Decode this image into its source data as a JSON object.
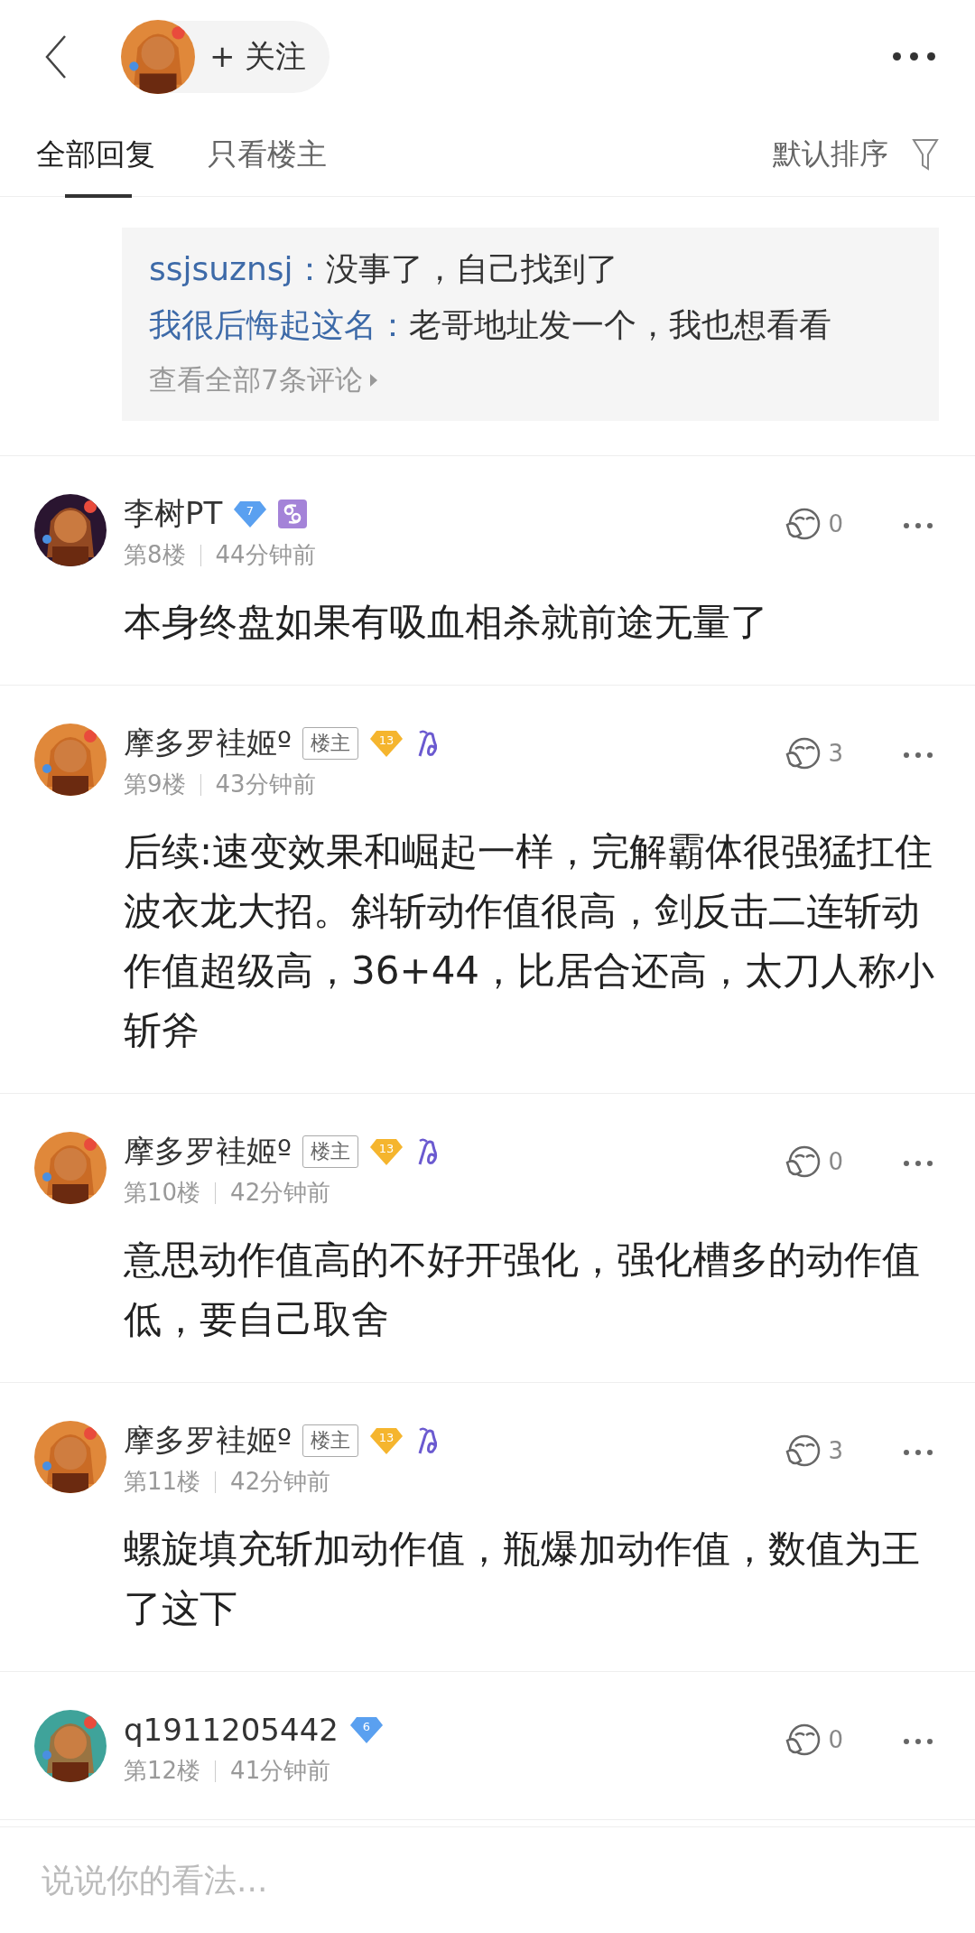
{
  "header": {
    "follow_label": "+ 关注"
  },
  "tabs": [
    {
      "label": "全部回复",
      "selected": true
    },
    {
      "label": "只看楼主",
      "selected": false
    }
  ],
  "sort": {
    "label": "默认排序"
  },
  "replies": {
    "items": [
      {
        "author": "ssjsuznsj：",
        "text": "没事了，自己找到了"
      },
      {
        "author": "我很后悔起这名：",
        "text": "老哥地址发一个，我也想看看"
      }
    ],
    "more": "查看全部7条评论"
  },
  "comments": [
    {
      "name": "李树PT",
      "badge": {
        "label": "7",
        "color": "#5aa0f0"
      },
      "sign": {
        "kind": "cancer"
      },
      "floor": "第8楼",
      "time": "44分钟前",
      "likes": "0",
      "body": "本身终盘如果有吸血相杀就前途无量了"
    },
    {
      "name": "摩多罗袿姬º",
      "op_tag": "楼主",
      "badge": {
        "label": "13",
        "color": "#f5b52e"
      },
      "sign": {
        "kind": "capricorn"
      },
      "floor": "第9楼",
      "time": "43分钟前",
      "likes": "3",
      "body": "后续:速变效果和崛起一样，完解霸体很强猛扛住波衣龙大招。斜斩动作值很高，剑反击二连斩动作值超级高，36+44，比居合还高，太刀人称小斩斧"
    },
    {
      "name": "摩多罗袿姬º",
      "op_tag": "楼主",
      "badge": {
        "label": "13",
        "color": "#f5b52e"
      },
      "sign": {
        "kind": "capricorn"
      },
      "floor": "第10楼",
      "time": "42分钟前",
      "likes": "0",
      "body": "意思动作值高的不好开强化，强化槽多的动作值低，要自己取舍"
    },
    {
      "name": "摩多罗袿姬º",
      "op_tag": "楼主",
      "badge": {
        "label": "13",
        "color": "#f5b52e"
      },
      "sign": {
        "kind": "capricorn"
      },
      "floor": "第11楼",
      "time": "42分钟前",
      "likes": "3",
      "body": "螺旋填充斩加动作值，瓶爆加动作值，数值为王了这下"
    },
    {
      "name": "q1911205442",
      "badge": {
        "label": "6",
        "color": "#5aa0f0"
      },
      "floor": "第12楼",
      "time": "41分钟前",
      "likes": "0"
    }
  ],
  "input": {
    "placeholder": "说说你的看法..."
  }
}
